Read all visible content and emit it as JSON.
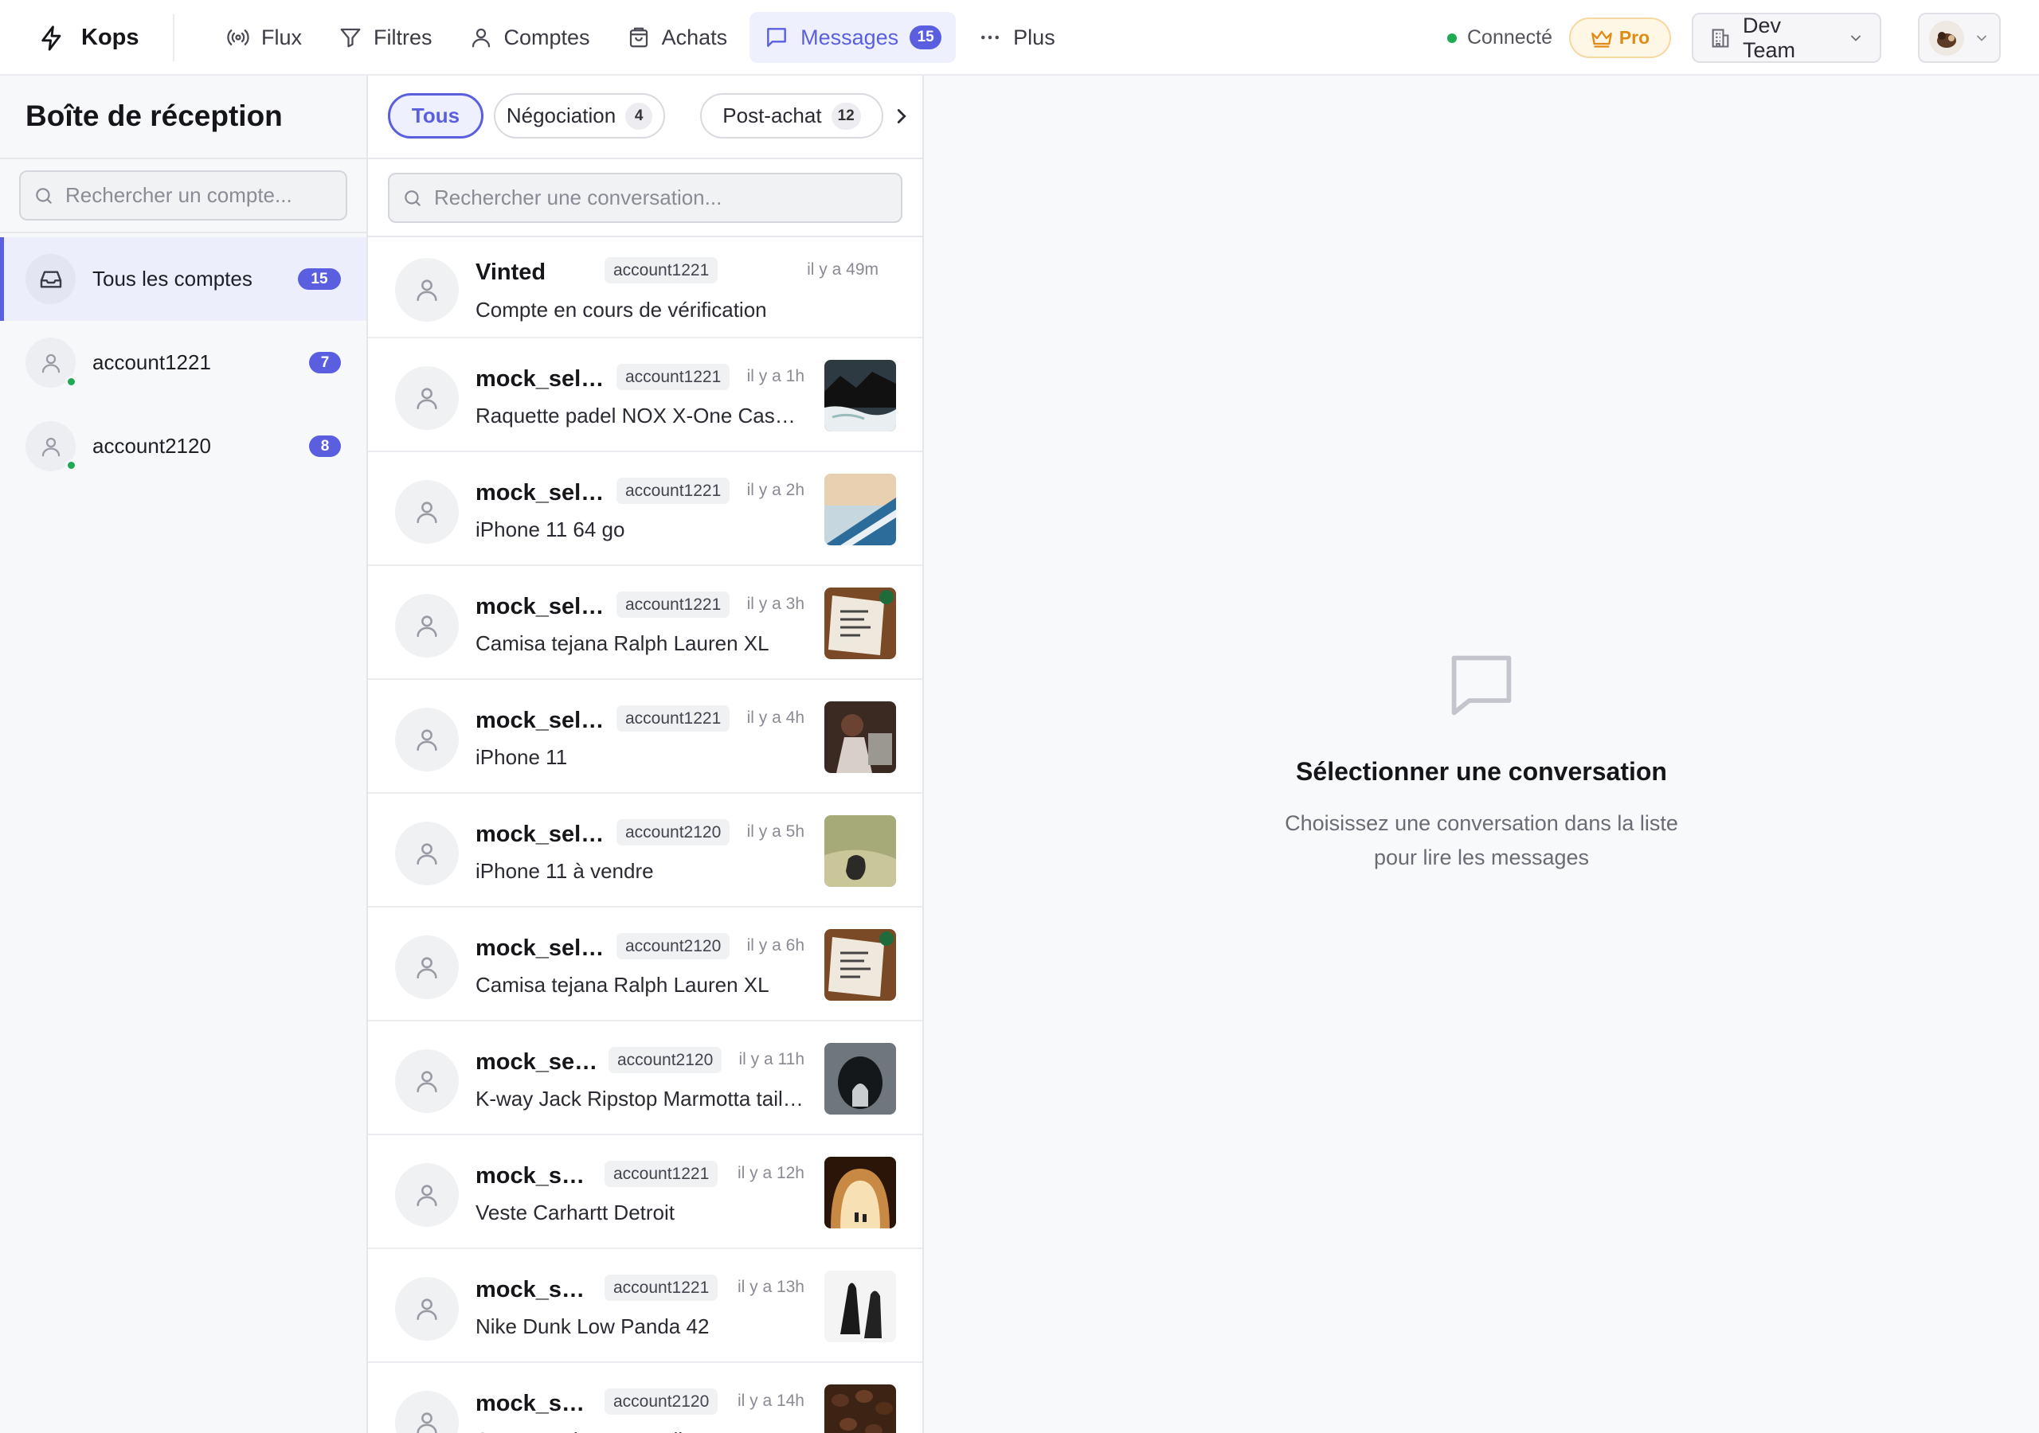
{
  "app": {
    "name": "Kops"
  },
  "nav": [
    {
      "label": "Flux",
      "icon": "broadcast-icon"
    },
    {
      "label": "Filtres",
      "icon": "filter-icon"
    },
    {
      "label": "Comptes",
      "icon": "user-icon"
    },
    {
      "label": "Achats",
      "icon": "shopping-bag-icon"
    },
    {
      "label": "Messages",
      "icon": "message-icon",
      "badge": "15",
      "active": true
    },
    {
      "label": "Plus",
      "icon": "more-dots-icon"
    }
  ],
  "status": {
    "label": "Connecté",
    "color": "#1faa52"
  },
  "plan": {
    "label": "Pro"
  },
  "team": {
    "label": "Dev Team"
  },
  "accounts": {
    "title": "Boîte de réception",
    "search_placeholder": "Rechercher un compte...",
    "items": [
      {
        "label": "Tous les comptes",
        "count": "15",
        "active": true
      },
      {
        "label": "account1221",
        "count": "7",
        "online": true
      },
      {
        "label": "account2120",
        "count": "8",
        "online": true
      }
    ]
  },
  "filters": [
    {
      "label": "Tous",
      "active": true
    },
    {
      "label": "Négociation",
      "count": "4"
    },
    {
      "label": "Post-achat",
      "count": "12"
    }
  ],
  "conversations": {
    "search_placeholder": "Rechercher une conversation...",
    "items": [
      {
        "name": "Vinted",
        "account": "account1221",
        "time": "il y a 49m",
        "preview": "Compte en cours de vérification",
        "thumb": null
      },
      {
        "name": "mock_sell…",
        "account": "account1221",
        "time": "il y a 1h",
        "preview": "Raquette padel NOX X-One Cas…",
        "thumb": "rocky-coast"
      },
      {
        "name": "mock_sell…",
        "account": "account1221",
        "time": "il y a 2h",
        "preview": "iPhone 11 64 go",
        "thumb": "sky-wing"
      },
      {
        "name": "mock_sell…",
        "account": "account1221",
        "time": "il y a 3h",
        "preview": "Camisa tejana Ralph Lauren XL",
        "thumb": "notebook-desk"
      },
      {
        "name": "mock_sell…",
        "account": "account1221",
        "time": "il y a 4h",
        "preview": "iPhone 11",
        "thumb": "person-laptop"
      },
      {
        "name": "mock_sell…",
        "account": "account2120",
        "time": "il y a 5h",
        "preview": "iPhone 11 à vendre",
        "thumb": "grass-field"
      },
      {
        "name": "mock_sell…",
        "account": "account2120",
        "time": "il y a 6h",
        "preview": "Camisa tejana Ralph Lauren XL",
        "thumb": "notebook-desk"
      },
      {
        "name": "mock_sel…",
        "account": "account2120",
        "time": "il y a 11h",
        "preview": "K-way Jack Ripstop Marmotta tail…",
        "thumb": "cave"
      },
      {
        "name": "mock_se…",
        "account": "account1221",
        "time": "il y a 12h",
        "preview": "Veste Carhartt Detroit",
        "thumb": "tunnel-light"
      },
      {
        "name": "mock_se…",
        "account": "account1221",
        "time": "il y a 13h",
        "preview": "Nike Dunk Low Panda 42",
        "thumb": "feet"
      },
      {
        "name": "mock_se…",
        "account": "account2120",
        "time": "il y a 14h",
        "preview": "Sac Longchamp Le Pliage M",
        "thumb": "coffee-beans"
      }
    ]
  },
  "empty_state": {
    "title": "Sélectionner une conversation",
    "line1": "Choisissez une conversation dans la liste",
    "line2": "pour lire les messages"
  },
  "colors": {
    "accent": "#5a5fe0",
    "pro": "#e08a17",
    "online": "#1faa52"
  }
}
